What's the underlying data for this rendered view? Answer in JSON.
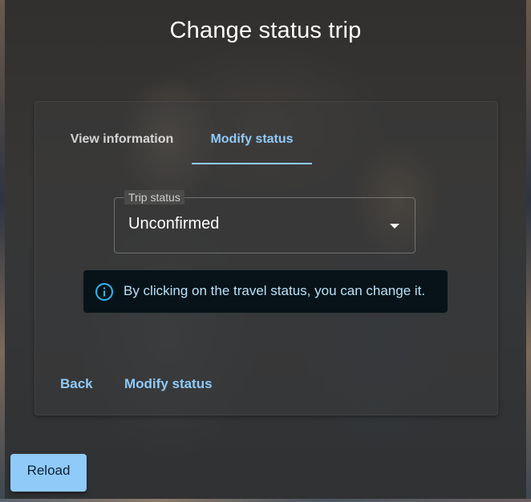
{
  "dialog": {
    "title": "Change status trip"
  },
  "tabs": [
    {
      "label": "View information",
      "active": false
    },
    {
      "label": "Modify status",
      "active": true
    }
  ],
  "trip_status_field": {
    "label": "Trip status",
    "value": "Unconfirmed",
    "icon": "chevron-down-icon"
  },
  "info_alert": {
    "icon": "info-icon",
    "text": "By clicking on the travel status, you can change it."
  },
  "actions": {
    "back_label": "Back",
    "modify_label": "Modify status"
  },
  "reload_label": "Reload",
  "colors": {
    "accent": "#90caf9",
    "alert_bg": "#071318",
    "alert_text": "#b8e1f8"
  }
}
